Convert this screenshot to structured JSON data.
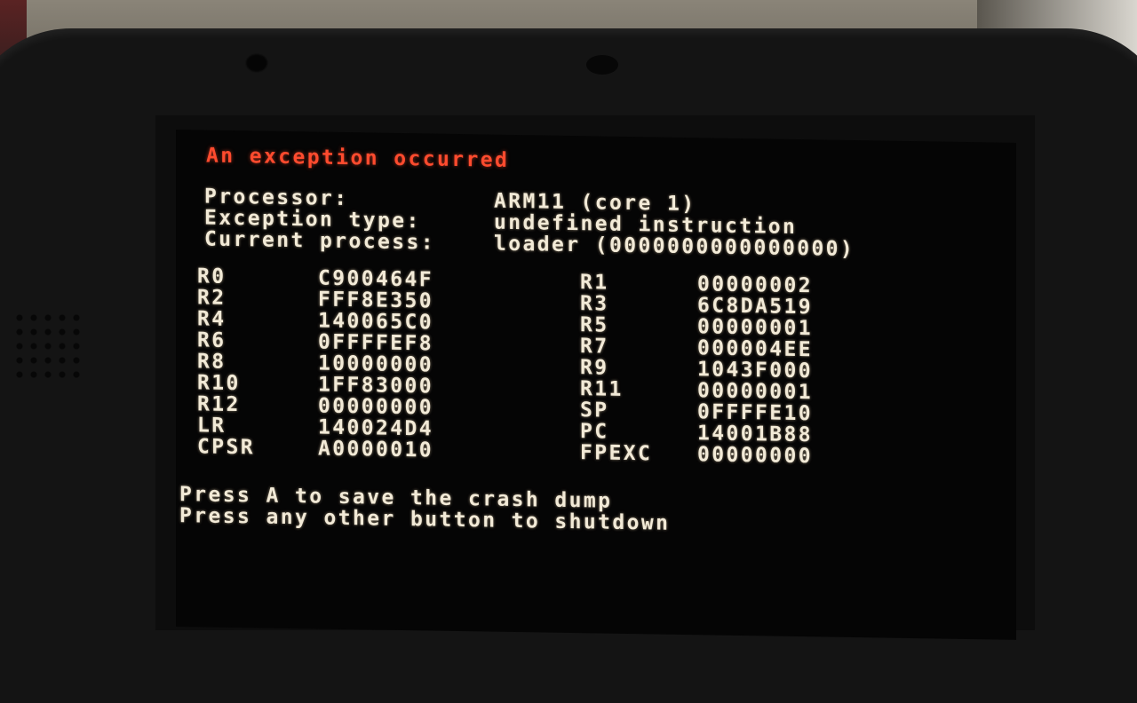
{
  "title": "An exception occurred",
  "info": [
    {
      "label": "Processor:",
      "value": "ARM11 (core 1)"
    },
    {
      "label": "Exception type:",
      "value": "undefined instruction"
    },
    {
      "label": "Current process:",
      "value": "loader (0000000000000000)"
    }
  ],
  "registers": [
    {
      "name1": "R0",
      "value1": "C900464F",
      "name2": "R1",
      "value2": "00000002"
    },
    {
      "name1": "R2",
      "value1": "FFF8E350",
      "name2": "R3",
      "value2": "6C8DA519"
    },
    {
      "name1": "R4",
      "value1": "140065C0",
      "name2": "R5",
      "value2": "00000001"
    },
    {
      "name1": "R6",
      "value1": "0FFFFEF8",
      "name2": "R7",
      "value2": "000004EE"
    },
    {
      "name1": "R8",
      "value1": "10000000",
      "name2": "R9",
      "value2": "1043F000"
    },
    {
      "name1": "R10",
      "value1": "1FF83000",
      "name2": "R11",
      "value2": "00000001"
    },
    {
      "name1": "R12",
      "value1": "00000000",
      "name2": "SP",
      "value2": "0FFFFE10"
    },
    {
      "name1": "LR",
      "value1": "140024D4",
      "name2": "PC",
      "value2": "14001B88"
    },
    {
      "name1": "CPSR",
      "value1": "A0000010",
      "name2": "FPEXC",
      "value2": "00000000"
    }
  ],
  "footer": [
    "Press A to save the crash dump",
    "Press any other button to shutdown"
  ],
  "colors": {
    "title": "#ff4b2e",
    "text": "#f2ead7",
    "screen_bg": "#050505"
  }
}
